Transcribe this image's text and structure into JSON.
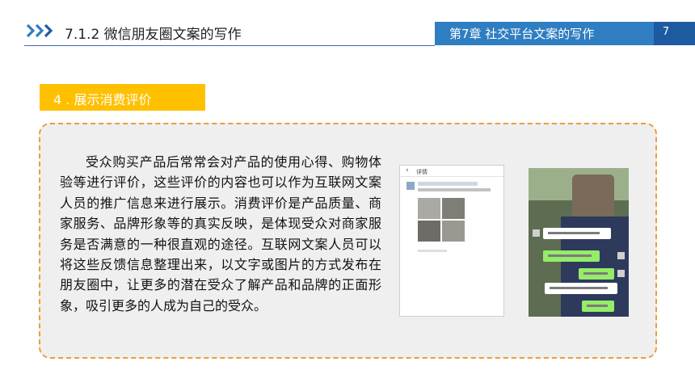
{
  "header": {
    "section_title": "7.1.2  微信朋友圈文案的写作",
    "chapter_title": "第7章   社交平台文案的写作",
    "page_number": "7",
    "icon": "triple-chevron-right-icon"
  },
  "section_tag": {
    "label": "4 . 展示消费评价"
  },
  "content": {
    "paragraph": "受众购买产品后常常会对产品的使用心得、购物体验等进行评价，这些评价的内容也可以作为互联网文案人员的推广信息来进行展示。消费评价是产品质量、商家服务、品牌形象等的真实反映，是体现受众对商家服务是否满意的一种很直观的途径。互联网文案人员可以将这些反馈信息整理出来，以文字或图片的方式发布在朋友圈中，让更多的潜在受众了解产品和品牌的正面形象，吸引更多的人成为自己的受众。"
  },
  "images": {
    "review_screenshot": {
      "header_text": "详情",
      "back_icon": "chevron-left-icon"
    }
  },
  "colors": {
    "accent_blue": "#2f7ec1",
    "dark_blue": "#1e5aa0",
    "tag_yellow": "#ffc000",
    "panel_border": "#f29a3b",
    "panel_bg": "#efefef"
  }
}
